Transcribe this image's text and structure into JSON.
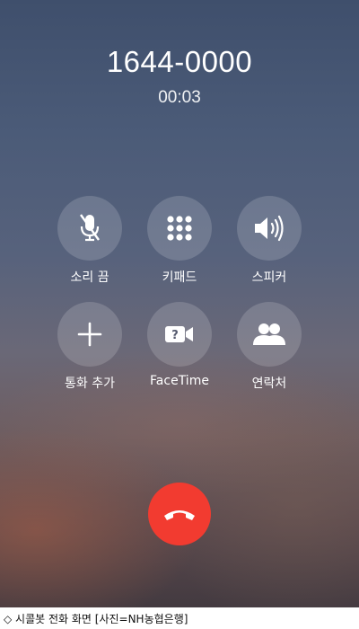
{
  "call": {
    "number": "1644-0000",
    "duration": "00:03"
  },
  "controls": [
    {
      "label": "소리 끔",
      "icon": "mic-muted-icon"
    },
    {
      "label": "키패드",
      "icon": "keypad-icon"
    },
    {
      "label": "스피커",
      "icon": "speaker-icon"
    },
    {
      "label": "통화 추가",
      "icon": "plus-icon"
    },
    {
      "label": "FaceTime",
      "icon": "facetime-icon"
    },
    {
      "label": "연락처",
      "icon": "contacts-icon"
    }
  ],
  "end_call": {
    "icon": "end-call-icon",
    "color": "#f23b30"
  },
  "caption": "◇ 시콜봇 전화 화면 [사진=NH농협은행]"
}
